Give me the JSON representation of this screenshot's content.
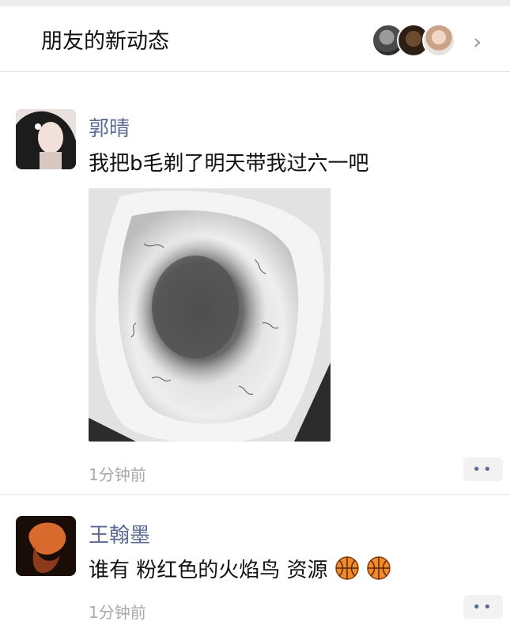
{
  "header": {
    "title": "朋友的新动态",
    "avatars": [
      "friend-avatar-1",
      "friend-avatar-2",
      "friend-avatar-3"
    ]
  },
  "posts": [
    {
      "name": "郭晴",
      "text": "我把b毛剃了明天带我过六一吧",
      "time": "1分钟前",
      "more": "••"
    },
    {
      "name": "王翰墨",
      "text": "谁有 粉红色的火焰鸟 资源",
      "time": "1分钟前",
      "more": "••",
      "emoji": [
        "basketball-icon",
        "basketball-icon"
      ]
    }
  ],
  "colors": {
    "name": "#5b6b93",
    "time": "#a8a8a8",
    "separator": "#ededed"
  }
}
